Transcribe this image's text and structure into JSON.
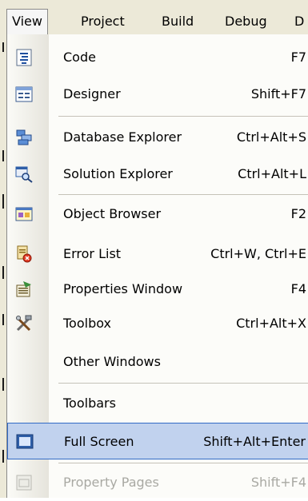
{
  "menubar": {
    "items": [
      {
        "label": "View",
        "active": true
      },
      {
        "label": "Project"
      },
      {
        "label": "Build"
      },
      {
        "label": "Debug"
      },
      {
        "label": "D"
      }
    ]
  },
  "menu": {
    "items": [
      {
        "label": "Code",
        "shortcut": "F7",
        "icon": "code-file-icon"
      },
      {
        "label": "Designer",
        "shortcut": "Shift+F7",
        "icon": "designer-form-icon"
      },
      {
        "label": "Database Explorer",
        "shortcut": "Ctrl+Alt+S",
        "icon": "database-servers-icon"
      },
      {
        "label": "Solution Explorer",
        "shortcut": "Ctrl+Alt+L",
        "icon": "solution-explorer-icon"
      },
      {
        "label": "Object Browser",
        "shortcut": "F2",
        "icon": "object-browser-icon"
      },
      {
        "label": "Error List",
        "shortcut": "Ctrl+W, Ctrl+E",
        "icon": "error-list-icon"
      },
      {
        "label": "Properties Window",
        "shortcut": "F4",
        "icon": "properties-window-icon"
      },
      {
        "label": "Toolbox",
        "shortcut": "Ctrl+Alt+X",
        "icon": "toolbox-tools-icon"
      },
      {
        "label": "Other Windows",
        "shortcut": ""
      },
      {
        "label": "Toolbars",
        "shortcut": ""
      },
      {
        "label": "Full Screen",
        "shortcut": "Shift+Alt+Enter",
        "icon": "full-screen-icon",
        "highlighted": true
      },
      {
        "label": "Property Pages",
        "shortcut": "Shift+F4",
        "icon": "property-pages-icon",
        "disabled": true
      }
    ]
  },
  "colors": {
    "highlight": "#c1d2ee",
    "highlight_border": "#316ac5",
    "menubar": "#ece9d8",
    "disabled_text": "#a9a9a3"
  }
}
